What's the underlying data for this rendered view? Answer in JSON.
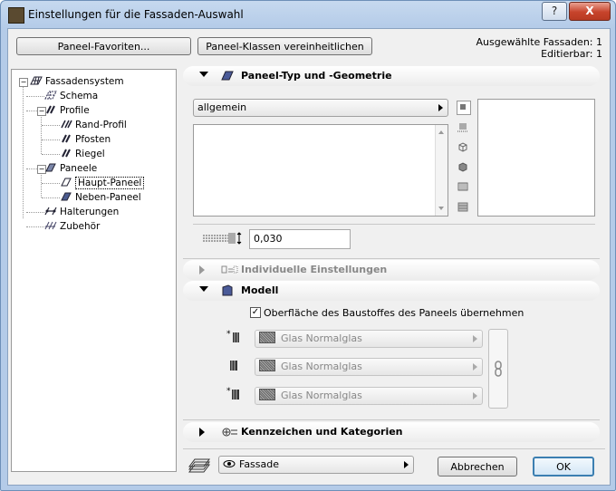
{
  "window": {
    "title": "Einstellungen für die Fassaden-Auswahl",
    "help_label": "?",
    "close_label": "X"
  },
  "toolbar": {
    "favorites_label": "Paneel-Favoriten...",
    "unify_label": "Paneel-Klassen vereinheitlichen"
  },
  "info": {
    "selected": "Ausgewählte Fassaden: 1",
    "editable": "Editierbar: 1"
  },
  "tree": {
    "root": "Fassadensystem",
    "schema": "Schema",
    "profile": "Profile",
    "rand": "Rand-Profil",
    "pfosten": "Pfosten",
    "riegel": "Riegel",
    "paneele": "Paneele",
    "haupt": "Haupt-Paneel",
    "neben": "Neben-Paneel",
    "halterungen": "Halterungen",
    "zubehoer": "Zubehör"
  },
  "sections": {
    "geometry": "Paneel-Typ und -Geometrie",
    "individual": "Individuelle Einstellungen",
    "model": "Modell",
    "tags": "Kennzeichen und Kategorien"
  },
  "geometry": {
    "type_value": "allgemein",
    "thickness_value": "0,030"
  },
  "model": {
    "override_label": "Oberfläche des Baustoffes des Paneels übernehmen",
    "override_checked": "✓",
    "surface1": "Glas Normalglas",
    "surface2": "Glas Normalglas",
    "surface3": "Glas Normalglas"
  },
  "footer": {
    "layer_value": "Fassade",
    "cancel_label": "Abbrechen",
    "ok_label": "OK"
  },
  "colors": {
    "accent": "#3c7fb1",
    "title_bar": "#b4cbe8"
  }
}
